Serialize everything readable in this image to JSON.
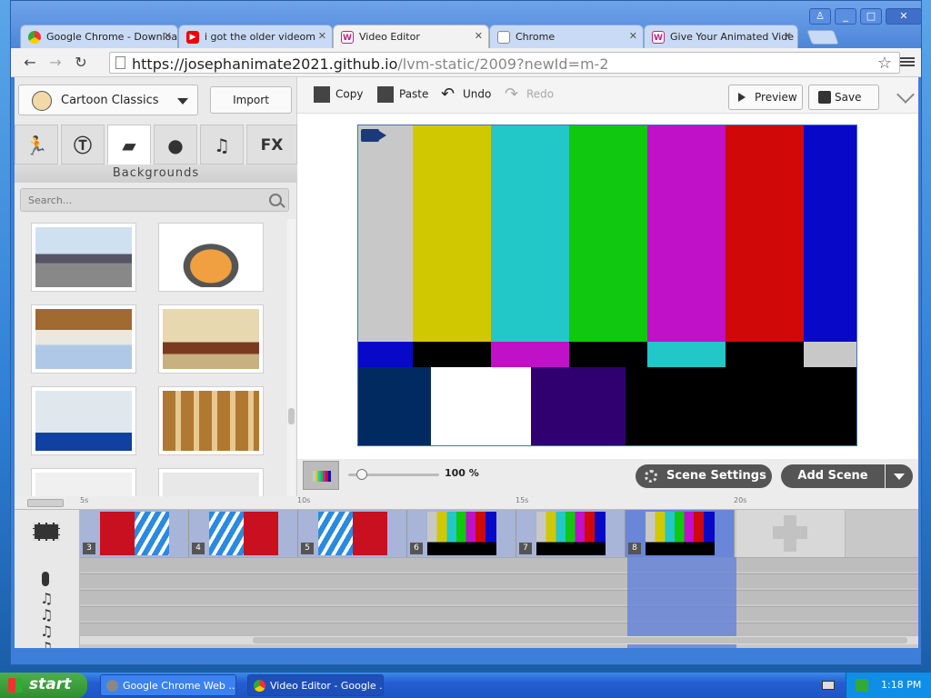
{
  "tabs": [
    {
      "label": "Google Chrome - Downloa",
      "icon": "chrome-icon",
      "active": false
    },
    {
      "label": "i got the older videom",
      "icon": "youtube-icon",
      "active": false
    },
    {
      "label": "Video Editor",
      "icon": "vyond-icon",
      "active": true
    },
    {
      "label": "Chrome",
      "icon": "page-icon",
      "active": false
    },
    {
      "label": "Give Your Animated Vide",
      "icon": "vyond-icon",
      "active": false
    }
  ],
  "address": {
    "host": "https://josephanimate2021.github.io",
    "path": "/lvm-static/2009?newId=m-2"
  },
  "left": {
    "theme": "Cartoon Classics",
    "import_label": "Import",
    "category_title": "Backgrounds",
    "fx_label": "FX",
    "search_placeholder": "Search..."
  },
  "toolbar": {
    "copy": "Copy",
    "paste": "Paste",
    "undo": "Undo",
    "redo": "Redo",
    "preview": "Preview",
    "save": "Save"
  },
  "controls": {
    "zoom_label": "100 %",
    "zoom_level": 0.1,
    "scene_settings": "Scene Settings",
    "add_scene": "Add Scene"
  },
  "timeline": {
    "ticks": [
      "5s",
      "10s",
      "15s",
      "20s"
    ],
    "scenes": [
      {
        "num": "3",
        "type": "stripes"
      },
      {
        "num": "4",
        "type": "stripes"
      },
      {
        "num": "5",
        "type": "stripes"
      },
      {
        "num": "6",
        "type": "bars"
      },
      {
        "num": "7",
        "type": "bars"
      },
      {
        "num": "8",
        "type": "bars",
        "selected": true
      }
    ]
  },
  "taskbar": {
    "start": "start",
    "tasks": [
      "Google Chrome Web ...",
      "Video Editor - Google ..."
    ],
    "clock": "1:18 PM"
  },
  "colors": {
    "gray": "#c8c8c8",
    "yellow": "#d0c800",
    "cyan": "#22c8c8",
    "green": "#10c810",
    "magenta": "#c010c8",
    "red": "#d00808",
    "blue": "#0808c8",
    "navy": "#002a60",
    "white": "#ffffff",
    "purple": "#300070",
    "black": "#000000"
  }
}
